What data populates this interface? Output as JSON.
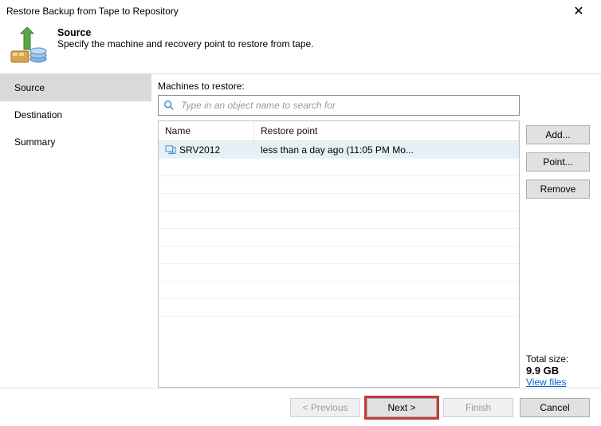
{
  "window_title": "Restore Backup from Tape to Repository",
  "header": {
    "heading": "Source",
    "sub": "Specify the machine and recovery point to restore from tape."
  },
  "sidebar": {
    "items": [
      "Source",
      "Destination",
      "Summary"
    ],
    "active_index": 0
  },
  "main": {
    "section_label": "Machines to restore:",
    "search_placeholder": "Type in an object name to search for",
    "table": {
      "headers": [
        "Name",
        "Restore point"
      ],
      "rows": [
        {
          "name": "SRV2012",
          "restore_point": "less than a day ago (11:05 PM Mo...",
          "selected": true
        }
      ]
    },
    "buttons": {
      "add": "Add...",
      "point": "Point...",
      "remove": "Remove"
    },
    "totals": {
      "label": "Total size:",
      "value": "9.9 GB",
      "link": "View files"
    }
  },
  "footer": {
    "prev": "< Previous",
    "next": "Next >",
    "finish": "Finish",
    "cancel": "Cancel"
  }
}
